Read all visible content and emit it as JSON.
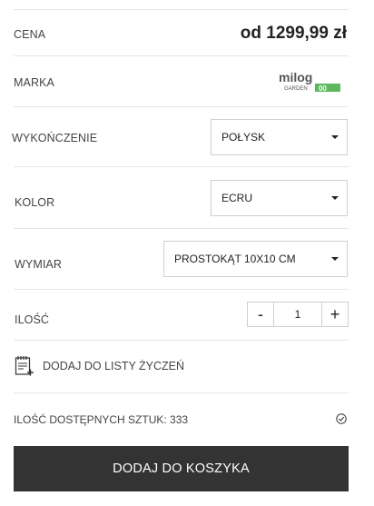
{
  "price_row": {
    "label": "CENA",
    "value": "od 1299,99 zł"
  },
  "brand_row": {
    "label": "MARKA",
    "logo": {
      "main_text": "milog",
      "sub_text": "GARDEN",
      "accent_text": "00",
      "accent_color": "#5cb85c"
    }
  },
  "finish_row": {
    "label": "WYKOŃCZENIE",
    "selected": "POŁYSK"
  },
  "color_row": {
    "label": "KOLOR",
    "selected": "ECRU"
  },
  "size_row": {
    "label": "WYMIAR",
    "selected": "PROSTOKĄT 10X10 CM"
  },
  "quantity_row": {
    "label": "ILOŚĆ",
    "minus": "-",
    "value": "1",
    "plus": "+"
  },
  "wishlist": {
    "label": "DODAJ DO LISTY ŻYCZEŃ",
    "icon": "notepad-plus-icon"
  },
  "stock": {
    "label": "ILOŚĆ DOSTĘPNYCH SZTUK: 333",
    "icon": "check-circle-icon"
  },
  "add_to_cart": {
    "label": "DODAJ DO KOSZYKA",
    "background": "#333333"
  }
}
